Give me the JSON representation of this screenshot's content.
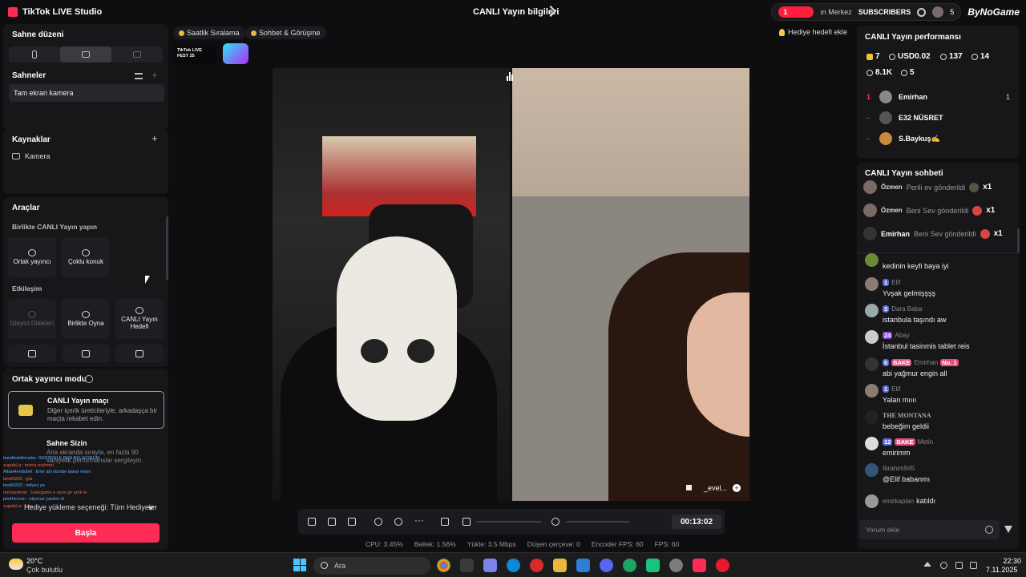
{
  "titlebar": {
    "app_name": "TikTok LIVE Studio",
    "window_title": "CANLI Yayın bilgileri",
    "notification_count": "1",
    "help_center": "ın Merkez",
    "subscribers_label": "SUBSCRIBERS",
    "subscribers_count": "5",
    "brand": "ByNoGame"
  },
  "left": {
    "scene_layout_title": "Sahne düzeni",
    "scenes_title": "Sahneler",
    "scene_item": "Tam ekran kamera",
    "sources_title": "Kaynaklar",
    "source_item": "Kamera",
    "tools_title": "Araçlar",
    "collab_title": "Birlikte CANLI Yayın yapın",
    "tools_collab": [
      {
        "label": "Ortak yayıncı",
        "icon": "link-icon"
      },
      {
        "label": "Çoklu konuk",
        "icon": "users-icon"
      }
    ],
    "interaction_title": "Etkileşim",
    "tools_interaction": [
      {
        "label": "İzleyici Dilekleri",
        "icon": "wish-icon"
      },
      {
        "label": "Birlikte Oyna",
        "icon": "play-together-icon"
      },
      {
        "label": "CANLI Yayın Hedefi",
        "icon": "goal-icon"
      }
    ],
    "cohost_mode_title": "Ortak yayıncı modu",
    "mode_card_title": "CANLI Yayın maçı",
    "mode_card_desc": "Diğer içerik üreticileriyle, arkadaşça bir maçta rekabet edin.",
    "mode2_title": "Sahne Sizin",
    "mode2_desc": "Ana ekranda sırayla, en fazla 90 saniyelik performanslar sergileyin.",
    "overlay_chat": [
      "bandindefirmeler: SERSENLE BEN BELIYORUM",
      "suguleLa : mircia mahmet",
      "AlfaeHendobel : Emir abi donate bakar mısın",
      "bestl0333 : gta",
      "bestl0333 : lettyez ya",
      "meriazdemir : bukegame e oyun gir artık la",
      "pentheroon : etiyoruz yardım et",
      "suguleLa : luxx"
    ],
    "gift_filter": "Hediye yükleme seçeneği: Tüm Hediyeler",
    "start_button": "Başla"
  },
  "center": {
    "chip_hourly": "Saatlik Sıralama",
    "chip_chat": "Sohbet & Görüşme",
    "fest_logo": "TikTok LIVE FEST 25",
    "gift_goal": "Hediye hedefi ekle",
    "guest_name": "_evel...",
    "timer": "00:13:02",
    "stats": {
      "cpu": "CPU: 3.45%",
      "mem": "Bellek: 1.56%",
      "upload": "Yükle: 3.5 Mbps",
      "dropped": "Düşen çerçeve: 0",
      "encoder": "Encoder FPS: 60",
      "fps": "FPS: 60"
    }
  },
  "perf": {
    "title": "CANLI Yayın performansı",
    "diamonds": "7",
    "usd": "USD0.02",
    "viewers": "137",
    "new_followers": "14",
    "likes": "8.1K",
    "gifters": "5",
    "ranking": [
      {
        "rank": "1",
        "name": "Emirhan",
        "score": "1"
      },
      {
        "rank": "-",
        "name": "E32 NÜSRET",
        "score": ""
      },
      {
        "rank": "-",
        "name": "S.Baykuş✍",
        "score": ""
      }
    ]
  },
  "chat": {
    "title": "CANLI Yayın sohbeti",
    "gift_events": [
      {
        "name": "Özmen",
        "action": "Perili ev gönderildi",
        "count": "x1"
      },
      {
        "name": "Özmen",
        "action": "Beni Sev gönderildi",
        "count": "x1"
      },
      {
        "name": "Emirhan",
        "action": "Beni Sev gönderildi",
        "count": "x1"
      }
    ],
    "messages": [
      {
        "level": "",
        "team": "",
        "user": "",
        "rank": "",
        "text": "kedinin keyfi bayа iyi"
      },
      {
        "level": "1",
        "team": "",
        "user": "Elif",
        "rank": "",
        "text": "Yvşak gelmişşşş"
      },
      {
        "level": "3",
        "team": "",
        "user": "Dara Baba",
        "rank": "",
        "text": "istanbula taşındı aw"
      },
      {
        "level": "24",
        "team": "",
        "user": "Abay",
        "rank": "",
        "text": "İstanbul tasinmis tablet reis"
      },
      {
        "level": "6",
        "team": "BAKE",
        "user": "Emirhan",
        "rank": "No. 1",
        "text": "abi yağmur engin all"
      },
      {
        "level": "1",
        "team": "",
        "user": "Elif",
        "rank": "",
        "text": "Yalan mıııı"
      },
      {
        "level": "",
        "team": "",
        "user": "THE MONTANA",
        "rank": "",
        "text": "bebeğim geldii"
      },
      {
        "level": "12",
        "team": "BAKE",
        "user": "Metin",
        "rank": "",
        "text": "emirimm"
      },
      {
        "level": "",
        "team": "",
        "user": "İbrahim945",
        "rank": "",
        "text": "@Elif babanmı"
      },
      {
        "level": "",
        "team": "",
        "user": "emirkaplan",
        "rank": "",
        "text": "katıldı"
      }
    ],
    "input_placeholder": "Yorum ekle"
  },
  "taskbar": {
    "weather_badge": "6",
    "temp": "20°C",
    "weather": "Çok bulutlu",
    "search": "Ara",
    "time": "22:30",
    "date": "7.11.2025"
  }
}
